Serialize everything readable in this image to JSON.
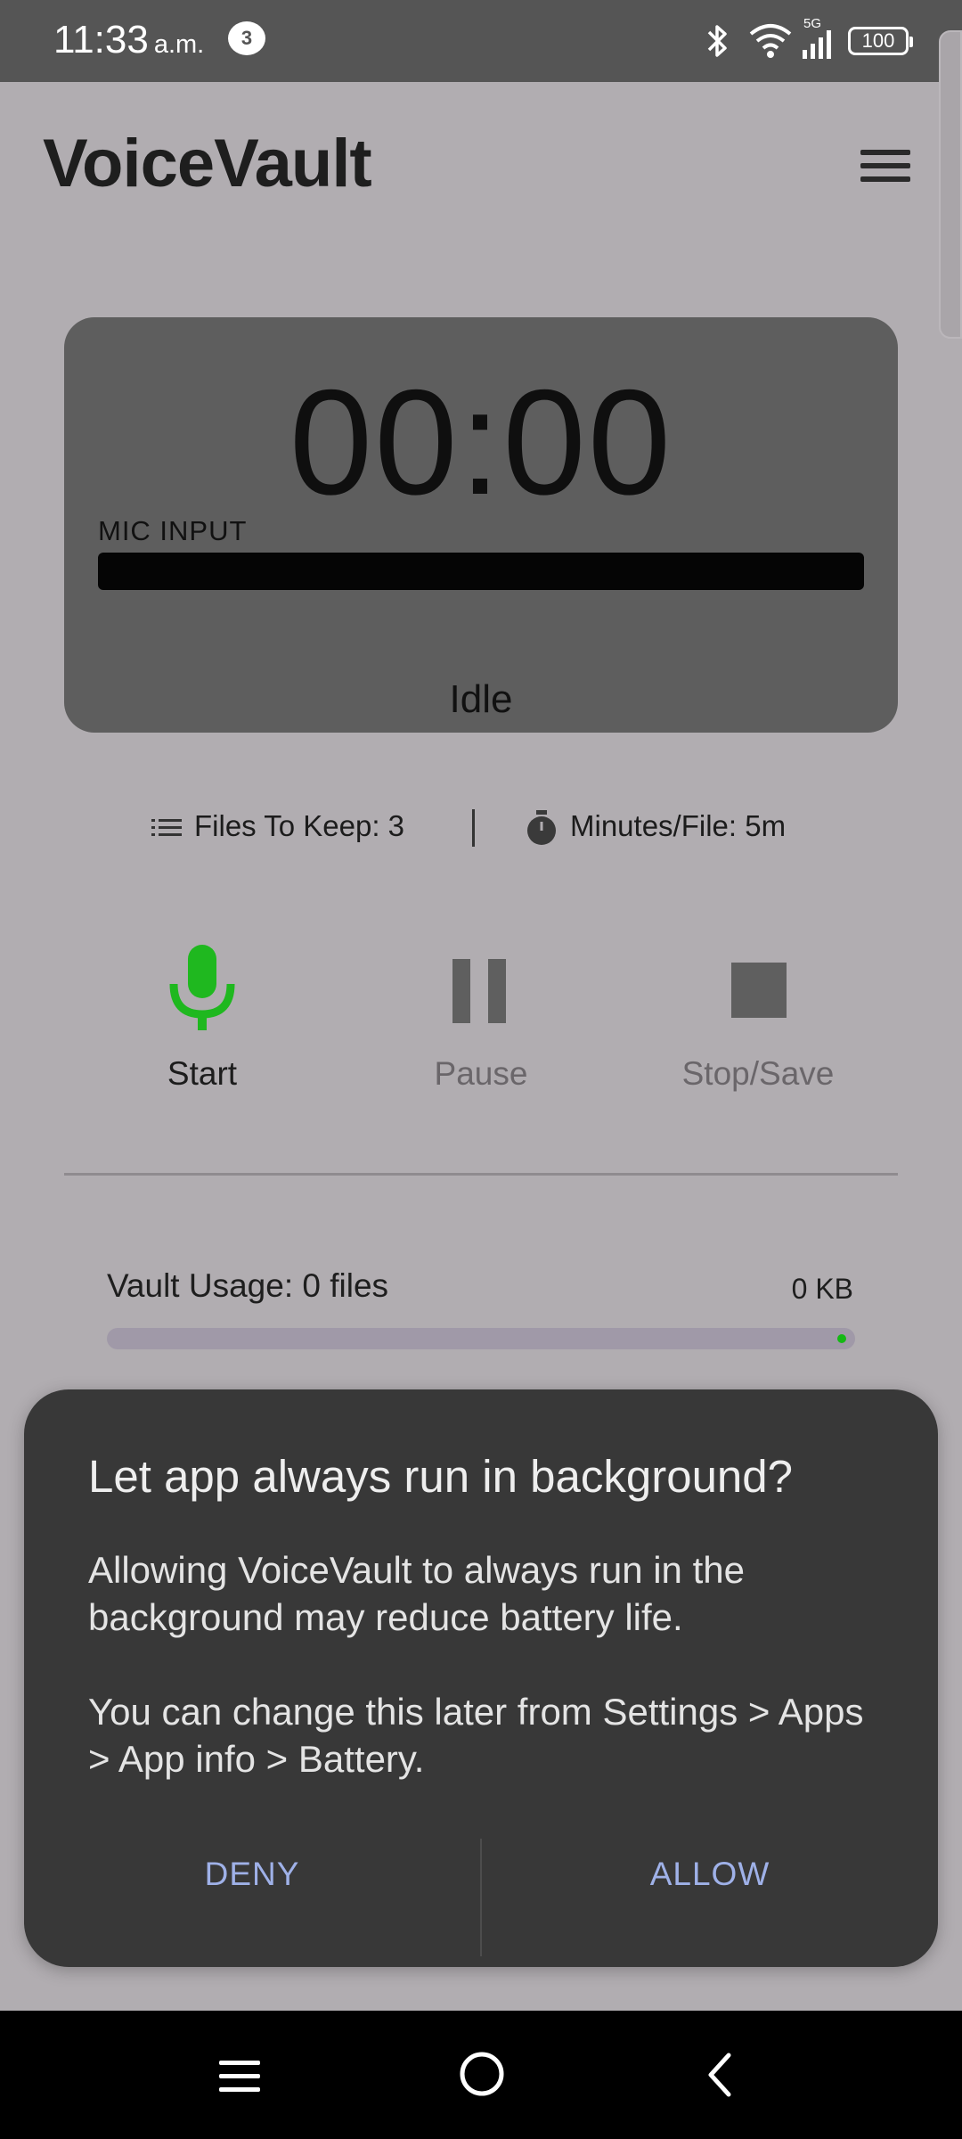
{
  "status_bar": {
    "time": "11:33",
    "ampm": "a.m.",
    "notification_count": "3",
    "network": "5G",
    "battery": "100"
  },
  "header": {
    "title": "VoiceVault",
    "menu_icon": "hamburger-menu-icon"
  },
  "timer": {
    "value": "00:00",
    "mic_label": "MIC INPUT",
    "status": "Idle"
  },
  "settings": {
    "files_to_keep": "Files To Keep: 3",
    "minutes_per_file": "Minutes/File: 5m"
  },
  "controls": {
    "start_label": "Start",
    "pause_label": "Pause",
    "stop_label": "Stop/Save"
  },
  "vault": {
    "usage_label": "Vault Usage: 0 files",
    "size": "0 KB"
  },
  "dialog": {
    "title": "Let app always run in background?",
    "body_1": "Allowing VoiceVault to always run in the background may reduce battery life.",
    "body_2": "You can change this later from Settings > Apps > App info > Battery.",
    "deny_label": "DENY",
    "allow_label": "ALLOW"
  },
  "colors": {
    "mic_green": "#1fb81f",
    "dialog_bg": "#383838",
    "dialog_button": "#9fb1e8"
  }
}
